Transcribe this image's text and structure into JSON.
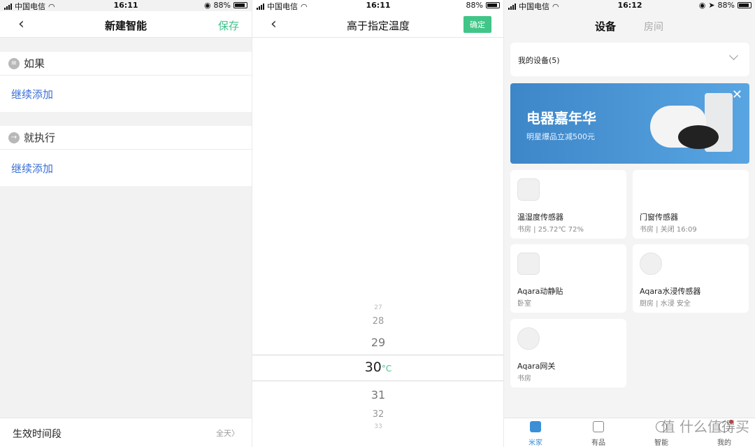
{
  "panel1": {
    "status": {
      "carrier": "中国电信",
      "time": "16:11",
      "battery": "88%"
    },
    "nav": {
      "back_glyph": "‹",
      "title": "新建智能",
      "save_label": "保存"
    },
    "if_section": {
      "header": "如果",
      "add_label": "继续添加"
    },
    "then_section": {
      "header": "就执行",
      "add_label": "继续添加"
    },
    "footer": {
      "label": "生效时间段",
      "value": "全天〉"
    }
  },
  "panel2": {
    "status": {
      "carrier": "中国电信",
      "time": "16:11",
      "battery": "88%"
    },
    "nav": {
      "back_glyph": "‹",
      "title": "高于指定温度",
      "confirm_label": "确定"
    },
    "picker": {
      "items": [
        "27",
        "28",
        "29",
        "30",
        "31",
        "32",
        "33"
      ],
      "selected": "30",
      "unit": "°C"
    }
  },
  "panel3": {
    "status": {
      "carrier": "中国电信",
      "time": "16:12",
      "battery": "88%"
    },
    "tabs": {
      "devices": "设备",
      "rooms": "房间"
    },
    "my_devices": "我的设备(5)",
    "banner": {
      "title": "电器嘉年华",
      "subtitle": "明星爆品立减500元",
      "close_glyph": "✕"
    },
    "devices": [
      {
        "name": "温湿度传感器",
        "status": "书房 | 25.72℃ 72%",
        "icon": "thermometer-icon"
      },
      {
        "name": "门窗传感器",
        "status": "书房 | 关闭 16:09",
        "icon": "door-sensor-icon"
      },
      {
        "name": "Aqara动静贴",
        "status": "卧室",
        "icon": "vibration-sensor-icon"
      },
      {
        "name": "Aqara水浸传感器",
        "status": "厨房 | 水浸 安全",
        "icon": "water-drop-icon"
      },
      {
        "name": "Aqara网关",
        "status": "书房",
        "icon": "gateway-icon"
      }
    ],
    "bottom_nav": [
      "米家",
      "有品",
      "智能",
      "我的"
    ],
    "watermark": "值 什么值得买"
  },
  "colors": {
    "accent_green": "#42c588",
    "link_blue": "#3a6fd6",
    "banner_blue": "#3d86c8",
    "active_blue": "#3a8fd6"
  }
}
